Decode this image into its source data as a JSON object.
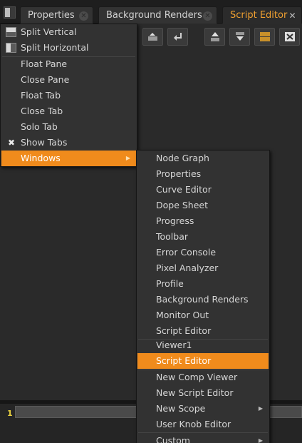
{
  "tabs": [
    {
      "label": "Properties",
      "active": false
    },
    {
      "label": "Background Renders",
      "active": false
    },
    {
      "label": "Script Editor",
      "active": true
    }
  ],
  "tab_close_glyph": "✕",
  "main_menu": {
    "split_vertical": "Split Vertical",
    "split_horizontal": "Split Horizontal",
    "float_pane": "Float Pane",
    "close_pane": "Close Pane",
    "float_tab": "Float Tab",
    "close_tab": "Close Tab",
    "solo_tab": "Solo Tab",
    "show_tabs": "Show Tabs",
    "windows": "Windows"
  },
  "windows_submenu": [
    "Node Graph",
    "Properties",
    "Curve Editor",
    "Dope Sheet",
    "Progress",
    "Toolbar",
    "Error Console",
    "Pixel Analyzer",
    "Profile",
    "Background Renders",
    "Monitor Out",
    "Script Editor",
    "Viewer1",
    "Script Editor",
    "New Comp Viewer",
    "New Script Editor",
    "New Scope",
    "User Knob Editor",
    "Custom"
  ],
  "script_input": {
    "line_number": "1",
    "value": ""
  },
  "colors": {
    "accent": "#f08b1c",
    "active_tab_text": "#f0a030",
    "background": "#282828",
    "menu_background": "#323232",
    "line_number": "#e8d040"
  },
  "icons": {
    "check": "✖",
    "submenu_arrow": "▶"
  }
}
